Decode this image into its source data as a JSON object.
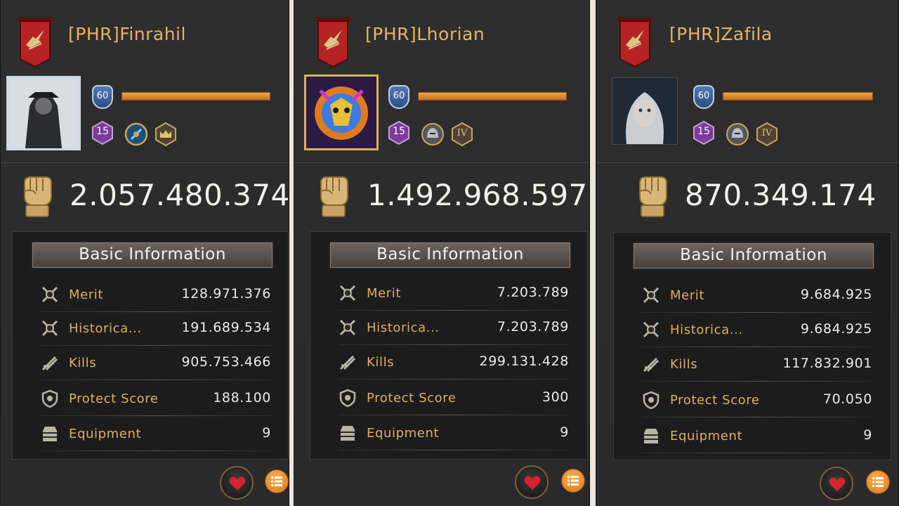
{
  "info_title": "Basic Information",
  "labels": {
    "merit": "Merit",
    "historical": "Historica...",
    "kills": "Kills",
    "protect": "Protect Score",
    "equipment": "Equipment"
  },
  "colors": {
    "name": "#e7b363",
    "label": "#e2ad63",
    "value": "#ecebe7",
    "panel": "#2c2c2c"
  },
  "players": [
    {
      "name": "[PHR]Finrahil",
      "level": "60",
      "rank_badge": "15",
      "xp_progress": 1.0,
      "badges": [
        "compass-badge-icon",
        "crown-badge-icon"
      ],
      "power": "2.057.480.374",
      "merit": "128.971.376",
      "historical": "191.689.534",
      "kills": "905.753.466",
      "protect": "188.100",
      "equipment": "9"
    },
    {
      "name": "[PHR]Lhorian",
      "level": "60",
      "rank_badge": "15",
      "xp_progress": 1.0,
      "badges": [
        "knight-helmet-badge-icon",
        "roman-four-badge-icon"
      ],
      "tier_numeral": "IV",
      "power": "1.492.968.597",
      "merit": "7.203.789",
      "historical": "7.203.789",
      "kills": "299.131.428",
      "protect": "300",
      "equipment": "9"
    },
    {
      "name": "[PHR]Zafila",
      "level": "60",
      "rank_badge": "15",
      "xp_progress": 1.0,
      "badges": [
        "knight-helmet-badge-icon",
        "roman-four-badge-icon"
      ],
      "tier_numeral": "IV",
      "power": "870.349.174",
      "merit": "9.684.925",
      "historical": "9.684.925",
      "kills": "117.832.901",
      "protect": "70.050",
      "equipment": "9"
    }
  ]
}
